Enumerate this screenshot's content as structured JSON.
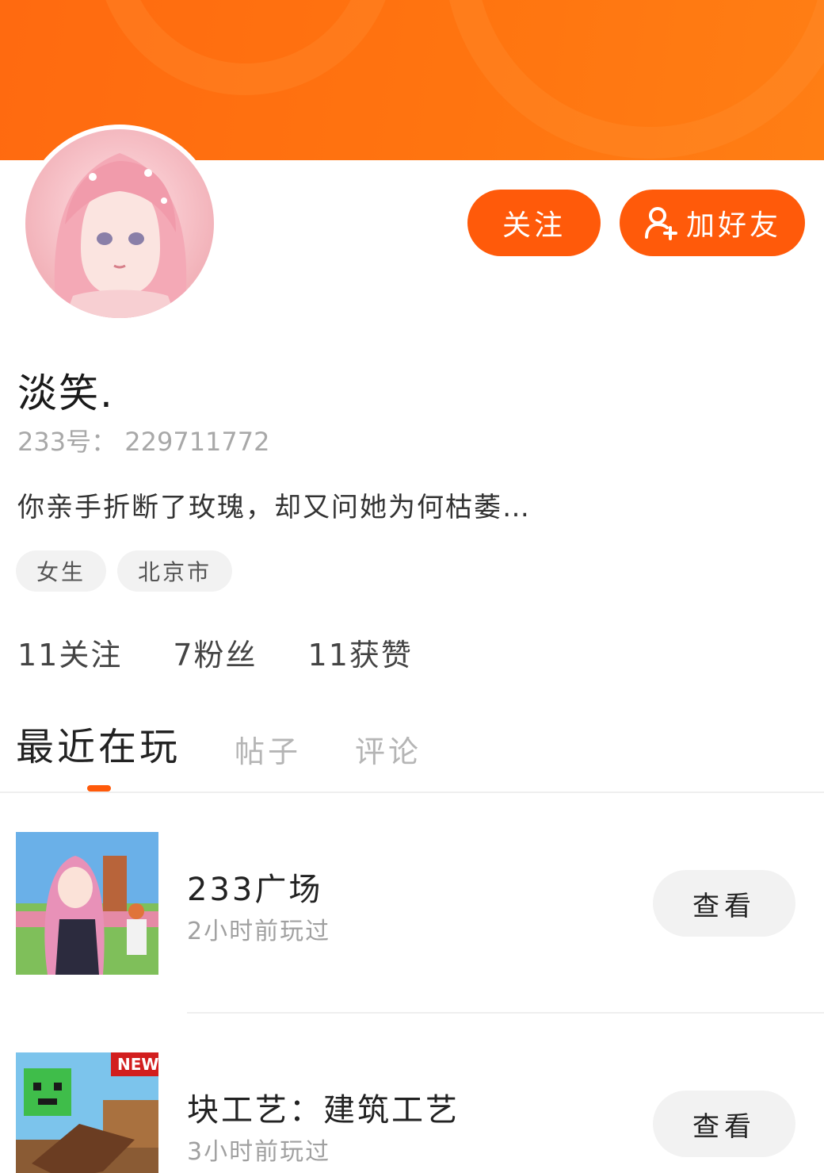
{
  "header": {
    "follow_label": "关注",
    "add_friend_label": "加好友",
    "accent_color": "#ff5a0a"
  },
  "profile": {
    "username": "淡笑.",
    "uid": "233号： 229711772",
    "bio": "你亲手折断了玫瑰，却又问她为何枯萎…",
    "tags": [
      "女生",
      "北京市"
    ],
    "stats": {
      "following": "11关注",
      "fans": "7粉丝",
      "likes": "11获赞"
    }
  },
  "tabs": [
    {
      "label": "最近在玩",
      "active": true
    },
    {
      "label": "帖子",
      "active": false
    },
    {
      "label": "评论",
      "active": false
    }
  ],
  "games": [
    {
      "title": "233广场",
      "subtitle": "2小时前玩过",
      "button_label": "查看"
    },
    {
      "title": "块工艺：建筑工艺",
      "subtitle": "3小时前玩过",
      "button_label": "查看",
      "badge": "NEW"
    }
  ],
  "icons": {
    "add_friend": "user-plus-icon"
  }
}
